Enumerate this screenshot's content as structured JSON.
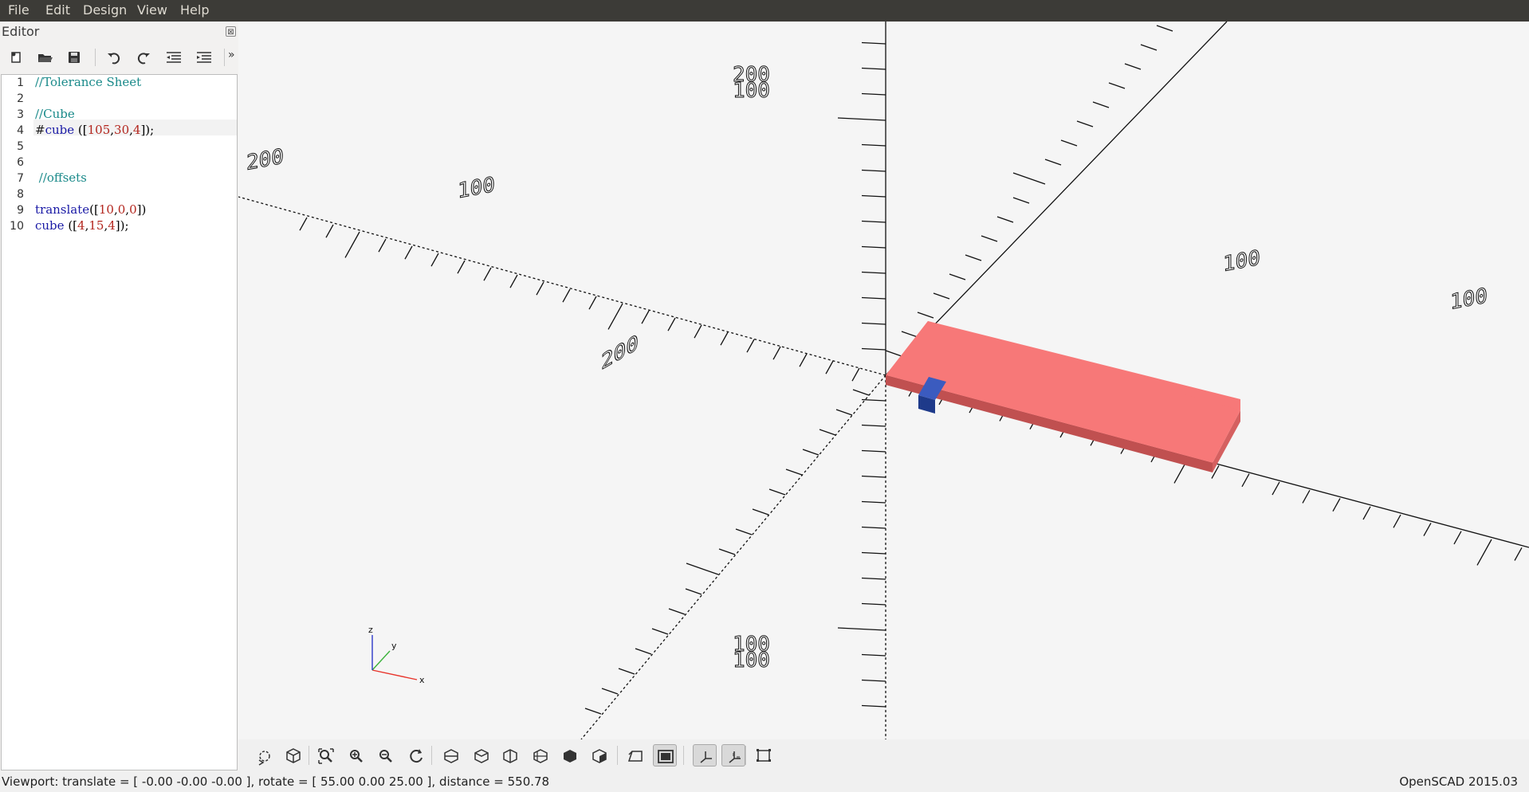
{
  "menubar": {
    "items": [
      "File",
      "Edit",
      "Design",
      "View",
      "Help"
    ]
  },
  "editor": {
    "title": "Editor",
    "close_glyph": "⊠",
    "toolbar_icons": [
      "new-file-icon",
      "open-file-icon",
      "save-icon",
      "undo-icon",
      "redo-icon",
      "unindent-icon",
      "indent-icon",
      "more-icon"
    ],
    "more_glyph": "»",
    "lines": [
      {
        "n": "1",
        "text": "//Tolerance Sheet"
      },
      {
        "n": "2",
        "text": ""
      },
      {
        "n": "3",
        "text": "//Cube"
      },
      {
        "n": "4",
        "text": "#cube ([105,30,4]);"
      },
      {
        "n": "5",
        "text": ""
      },
      {
        "n": "6",
        "text": ""
      },
      {
        "n": "7",
        "text": " //offsets"
      },
      {
        "n": "8",
        "text": ""
      },
      {
        "n": "9",
        "text": "translate([10,0,0])"
      },
      {
        "n": "10",
        "text": "cube ([4,15,4]);"
      }
    ]
  },
  "viewport": {
    "axis_labels": {
      "x": "x",
      "y": "y",
      "z": "z"
    },
    "tick_labels": [
      "200",
      "100",
      "100",
      "100",
      "200",
      "100",
      "200",
      "200",
      "100",
      "100"
    ],
    "colors": {
      "main_cube": "#f77878",
      "main_cube_side": "#c05050",
      "offset_cube": "#3b5bbf",
      "axis_x": "#e8332a",
      "axis_y": "#3cb33c",
      "axis_z": "#2c36c8"
    }
  },
  "view_toolbar": {
    "icons": [
      "preview-icon",
      "render-icon",
      "view-all-icon",
      "zoom-in-icon",
      "zoom-out-icon",
      "reset-view-icon",
      "view-right-icon",
      "view-top-icon",
      "view-bottom-icon",
      "view-left-icon",
      "view-front-icon",
      "view-back-icon",
      "perspective-icon",
      "orthogonal-icon",
      "show-axes-icon",
      "show-scale-markers-icon",
      "show-edges-icon"
    ]
  },
  "status": {
    "viewport_text": "Viewport: translate = [ -0.00 -0.00 -0.00 ], rotate = [ 55.00 0.00 25.00 ], distance = 550.78",
    "app_version": "OpenSCAD 2015.03"
  }
}
